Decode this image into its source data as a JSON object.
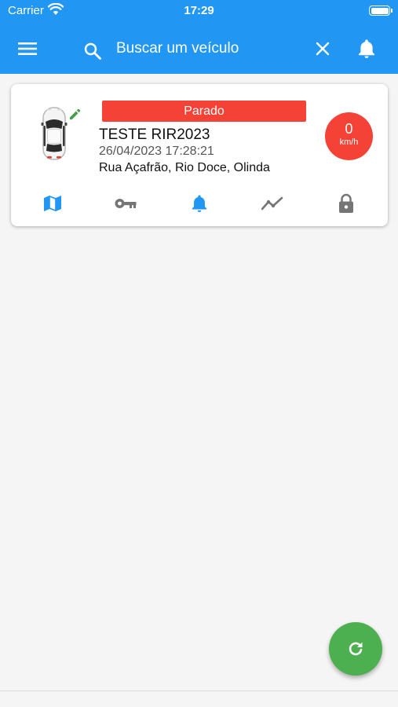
{
  "status_bar": {
    "carrier": "Carrier",
    "time": "17:29"
  },
  "toolbar": {
    "search_placeholder": "Buscar um veículo"
  },
  "vehicle_card": {
    "status": "Parado",
    "status_color": "#f44336",
    "name": "TESTE RIR2023",
    "datetime": "26/04/2023 17:28:21",
    "address": "Rua Açafrão, Rio Doce, Olinda",
    "speed": "0",
    "speed_unit": "km/h",
    "actions": [
      "map-icon",
      "key-icon",
      "bell-icon",
      "trend-icon",
      "lock-icon"
    ]
  },
  "colors": {
    "primary": "#2196f3",
    "danger": "#f44336",
    "success": "#4caf50",
    "edit": "#43a047"
  }
}
